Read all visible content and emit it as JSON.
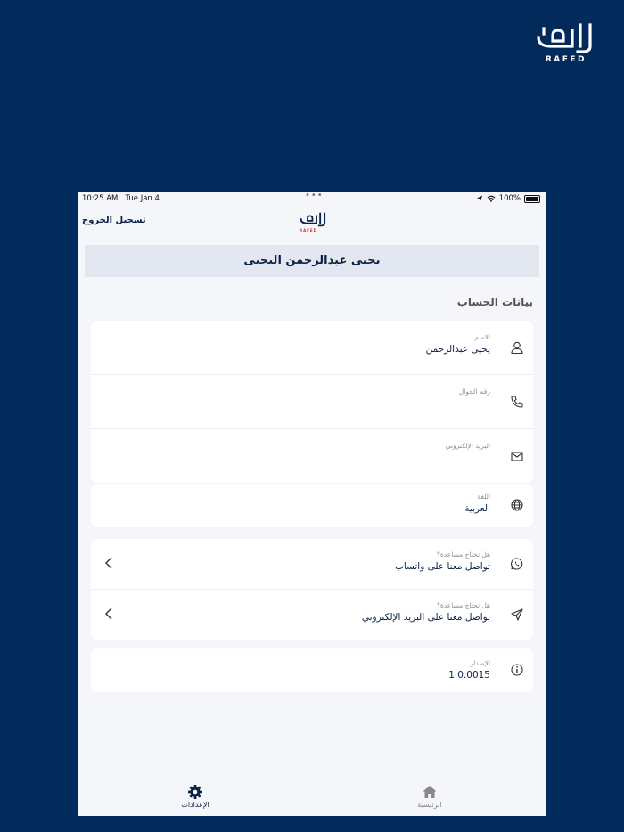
{
  "brand": {
    "wordmark": "RAFED",
    "mini_wordmark": "RAFED"
  },
  "statusbar": {
    "time": "10:25 AM",
    "date": "Tue Jan 4",
    "dots": "•••",
    "battery": "100%"
  },
  "topbar": {
    "logout_label": "تسجيل الخروج"
  },
  "user": {
    "name": "يحيى عبدالرحمن اليحيى"
  },
  "account": {
    "section_title": "بيانات الحساب",
    "name_label": "الاسم",
    "name_value": "يحيى عبدالرحمن",
    "phone_label": "رقم الجوال",
    "phone_value": "",
    "email_label": "البريد الإلكتروني",
    "email_value": ""
  },
  "language": {
    "label": "اللغة",
    "value": "العربية"
  },
  "help": {
    "whatsapp_label": "هل تحتاج مساعدة؟",
    "whatsapp_value": "تواصل معنا على واتساب",
    "email_label": "هل تحتاج مساعدة؟",
    "email_value": "تواصل معنا على البريد الإلكتروني"
  },
  "version": {
    "label": "الإصدار",
    "value": "1.0.0015"
  },
  "tabs": {
    "settings_label": "الإعدادات",
    "home_label": "الرئيسية"
  },
  "colors": {
    "background": "#022a5a",
    "primary": "#0d2247",
    "inactive": "#888888",
    "accent_red": "#c0392b"
  }
}
